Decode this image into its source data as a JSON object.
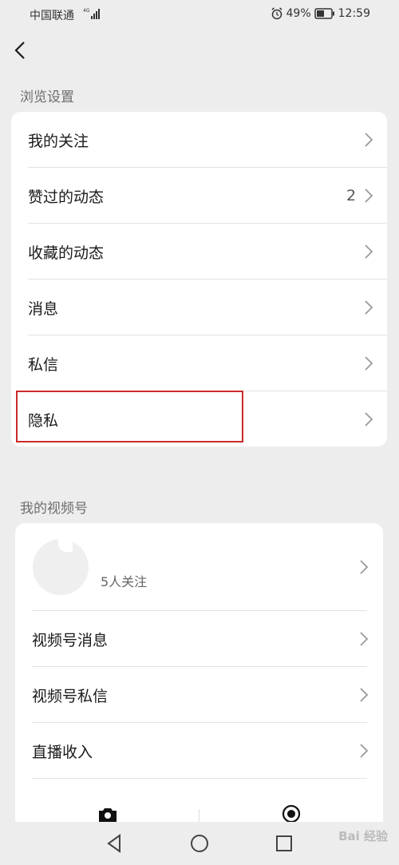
{
  "status_bar": {
    "carrier": "中国联通",
    "network": "4G",
    "battery_percent": "49%",
    "time": "12:59"
  },
  "sections": {
    "browse": {
      "title": "浏览设置",
      "items": [
        {
          "label": "我的关注",
          "count": ""
        },
        {
          "label": "赞过的动态",
          "count": "2"
        },
        {
          "label": "收藏的动态",
          "count": ""
        },
        {
          "label": "消息",
          "count": ""
        },
        {
          "label": "私信",
          "count": ""
        },
        {
          "label": "隐私",
          "count": ""
        }
      ]
    },
    "channels": {
      "title": "我的视频号",
      "profile": {
        "followers": "5人关注"
      },
      "items": [
        {
          "label": "视频号消息"
        },
        {
          "label": "视频号私信"
        },
        {
          "label": "直播收入"
        }
      ]
    }
  },
  "watermark": "Bai 经验",
  "colors": {
    "background": "#ededed",
    "card": "#ffffff",
    "highlight": "#cc2b2b"
  }
}
